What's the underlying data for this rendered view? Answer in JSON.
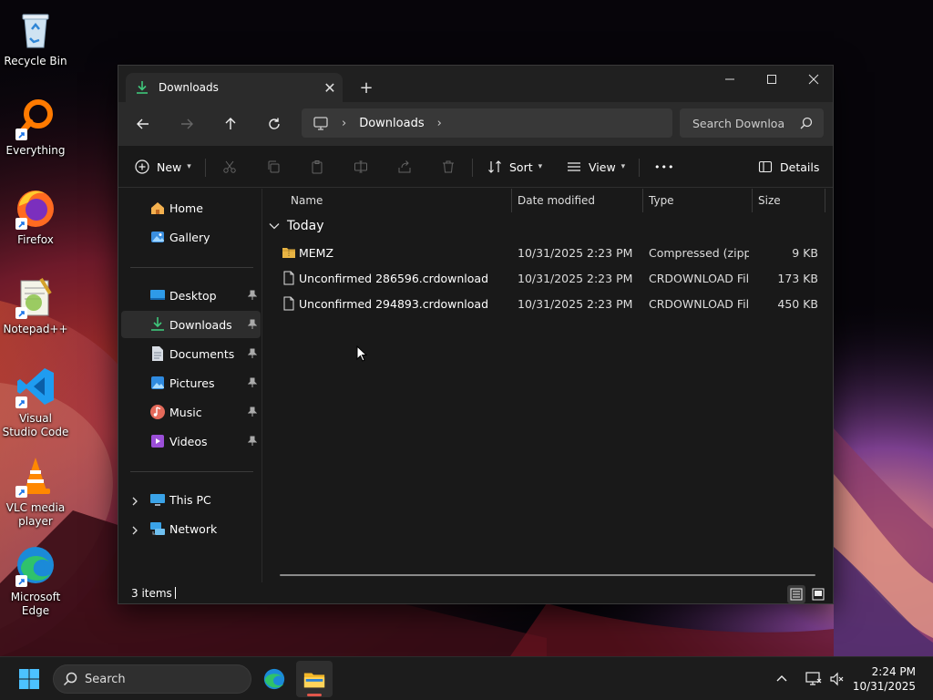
{
  "desktop": {
    "icons": [
      {
        "label": "Recycle Bin",
        "icon": "recycle-bin-icon",
        "shortcut": false
      },
      {
        "label": "Everything",
        "icon": "everything-search-icon",
        "shortcut": true
      },
      {
        "label": "Firefox",
        "icon": "firefox-icon",
        "shortcut": true
      },
      {
        "label": "Notepad++",
        "icon": "notepad-plus-plus-icon",
        "shortcut": true
      },
      {
        "label": "Visual Studio Code",
        "icon": "vscode-icon",
        "shortcut": true
      },
      {
        "label": "VLC media player",
        "icon": "vlc-icon",
        "shortcut": true
      },
      {
        "label": "Microsoft Edge",
        "icon": "edge-icon",
        "shortcut": true
      }
    ]
  },
  "window": {
    "tab_title": "Downloads",
    "new_tab_glyph": "+",
    "tab_close_glyph": "✕",
    "address": {
      "crumbs": [
        "Downloads"
      ]
    },
    "search_placeholder": "Search Downloa",
    "toolbar": {
      "new_label": "New",
      "sort_label": "Sort",
      "view_label": "View",
      "more_label": "•••",
      "details_label": "Details"
    },
    "sidebar": {
      "top": [
        {
          "label": "Home",
          "icon": "home-icon"
        },
        {
          "label": "Gallery",
          "icon": "gallery-icon"
        }
      ],
      "pinned": [
        {
          "label": "Desktop",
          "icon": "desktop-folder-icon"
        },
        {
          "label": "Downloads",
          "icon": "downloads-folder-icon",
          "selected": true
        },
        {
          "label": "Documents",
          "icon": "documents-folder-icon"
        },
        {
          "label": "Pictures",
          "icon": "pictures-folder-icon"
        },
        {
          "label": "Music",
          "icon": "music-folder-icon"
        },
        {
          "label": "Videos",
          "icon": "videos-folder-icon"
        }
      ],
      "bottom": [
        {
          "label": "This PC",
          "icon": "this-pc-icon"
        },
        {
          "label": "Network",
          "icon": "network-icon"
        }
      ]
    },
    "columns": [
      "Name",
      "Date modified",
      "Type",
      "Size"
    ],
    "group": "Today",
    "files": [
      {
        "name": "MEMZ",
        "date": "10/31/2025 2:23 PM",
        "type": "Compressed (zipp...",
        "size": "9 KB",
        "icon": "zip-folder-icon"
      },
      {
        "name": "Unconfirmed 286596.crdownload",
        "date": "10/31/2025 2:23 PM",
        "type": "CRDOWNLOAD File",
        "size": "173 KB",
        "icon": "file-icon"
      },
      {
        "name": "Unconfirmed 294893.crdownload",
        "date": "10/31/2025 2:23 PM",
        "type": "CRDOWNLOAD File",
        "size": "450 KB",
        "icon": "file-icon"
      }
    ],
    "status": {
      "count": "3 items"
    }
  },
  "taskbar": {
    "search_label": "Search",
    "clock_time": "2:24 PM",
    "clock_date": "10/31/2025",
    "apps": [
      {
        "name": "edge-taskbar-icon",
        "active": false
      },
      {
        "name": "file-explorer-taskbar-icon",
        "active": true
      }
    ]
  },
  "colors": {
    "accent_green": "#3fc67b",
    "window_bg": "#191919",
    "taskbar_bg": "#1c1c1c"
  }
}
